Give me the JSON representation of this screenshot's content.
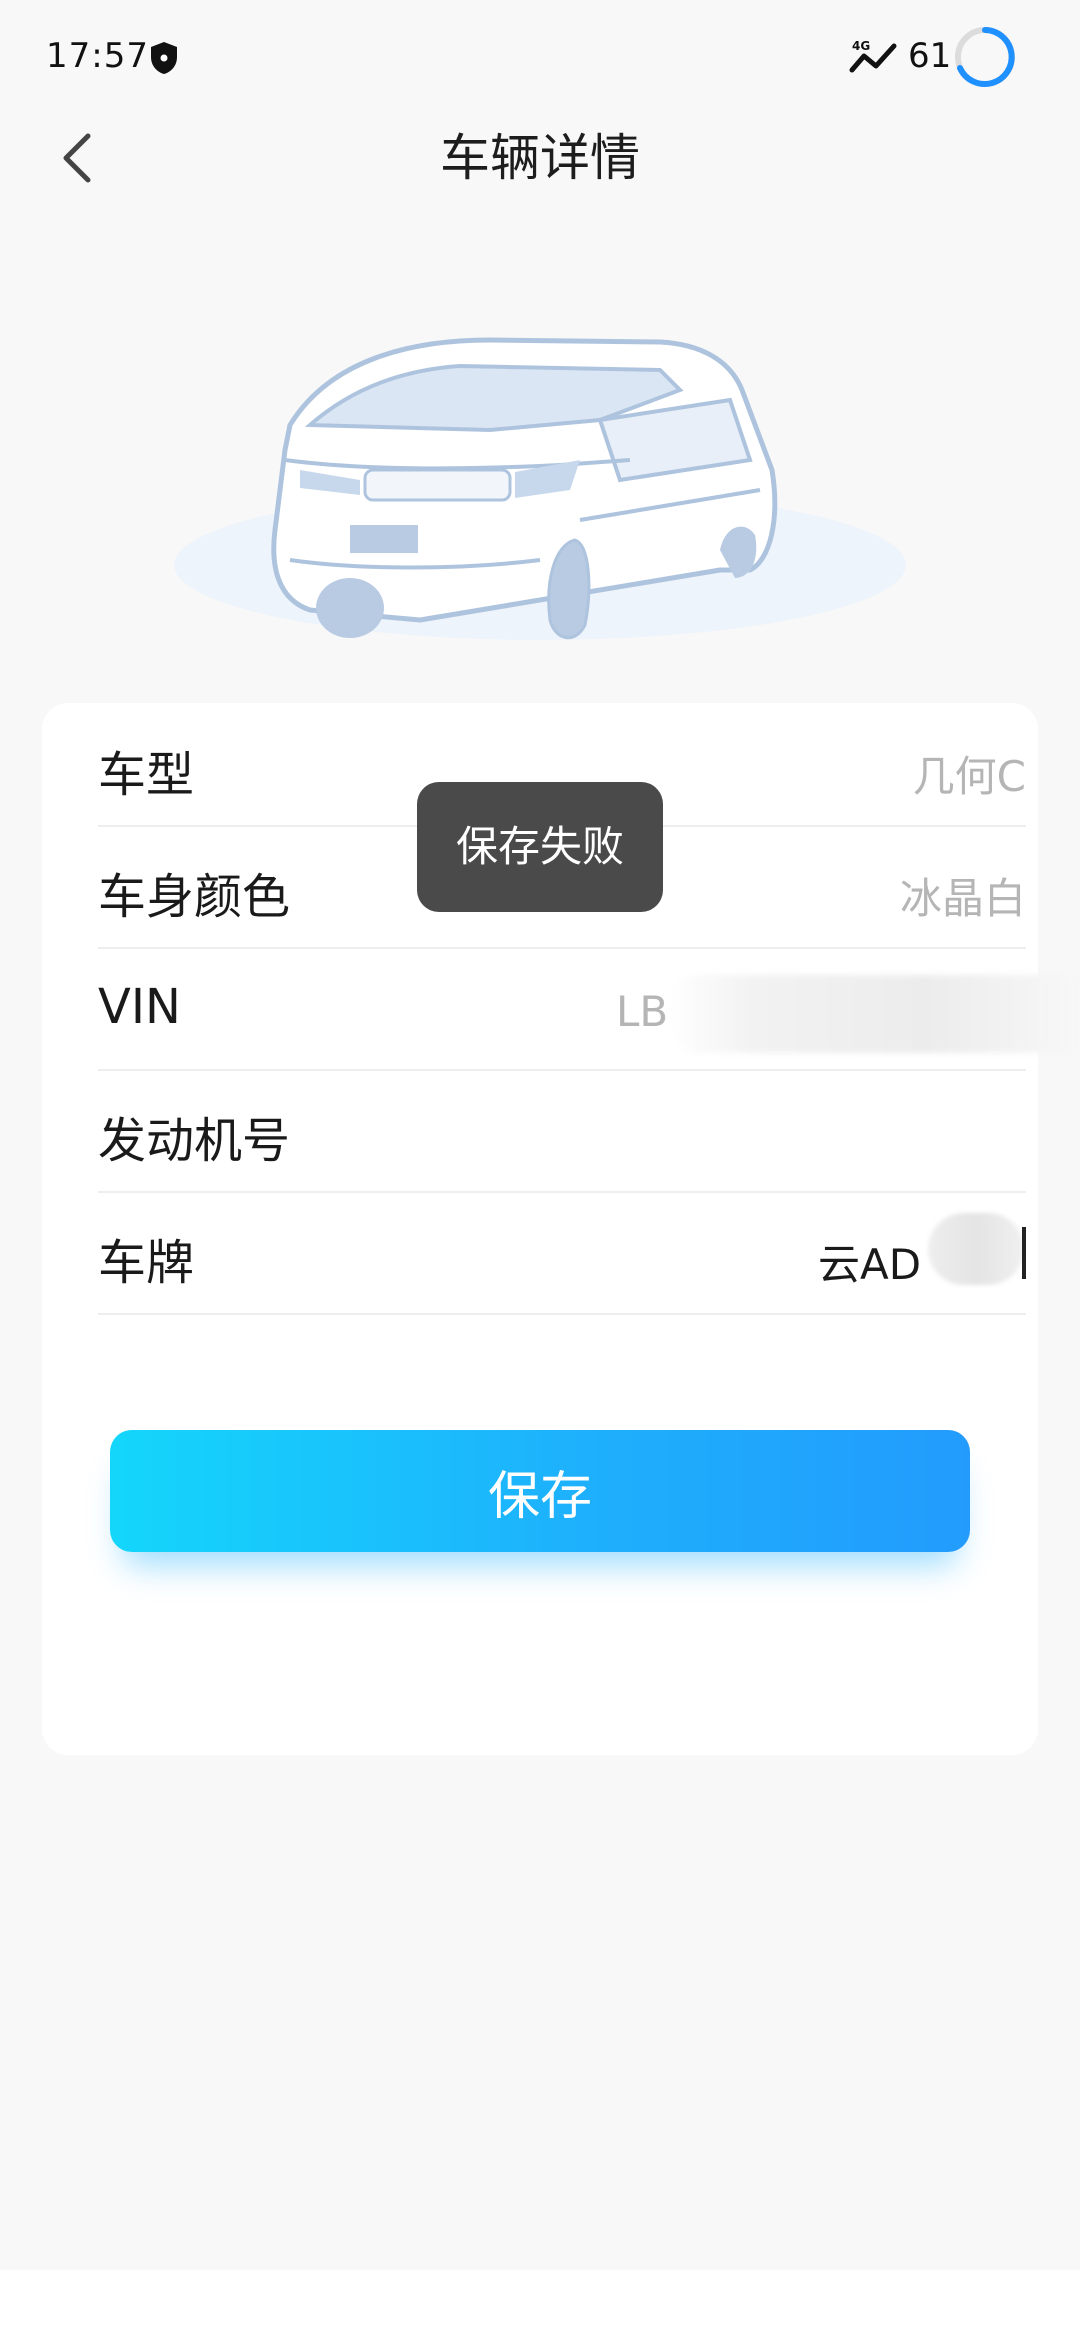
{
  "status_bar": {
    "time": "17:57",
    "network": "4G",
    "battery": "61"
  },
  "header": {
    "title": "车辆详情",
    "back_icon": "chevron-left-icon"
  },
  "illustration": {
    "icon": "car-illustration"
  },
  "form": {
    "rows": [
      {
        "label": "车型",
        "value": "几何C"
      },
      {
        "label": "车身颜色",
        "value": "冰晶白"
      },
      {
        "label": "VIN",
        "value": "LB"
      },
      {
        "label": "发动机号",
        "value": ""
      },
      {
        "label": "车牌",
        "value": "云AD"
      }
    ]
  },
  "actions": {
    "save_label": "保存"
  },
  "toast": {
    "message": "保存失败"
  },
  "colors": {
    "save_gradient_start": "#14d6fb",
    "save_gradient_end": "#229bfd",
    "toast_bg": "#4a4a4a",
    "placeholder_text": "#b5b5b5",
    "car_outline": "#aec4de"
  }
}
